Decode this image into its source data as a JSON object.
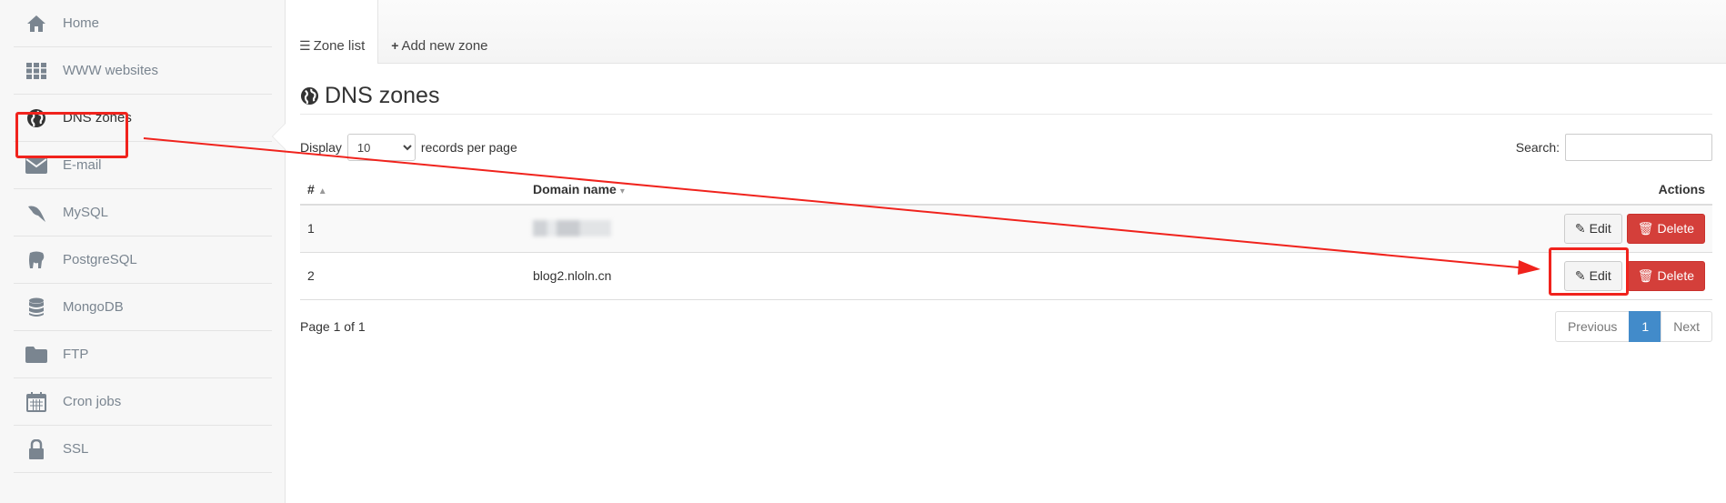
{
  "sidebar": {
    "items": [
      {
        "label": "Home",
        "icon": "home-icon"
      },
      {
        "label": "WWW websites",
        "icon": "grid-icon"
      },
      {
        "label": "DNS zones",
        "icon": "globe-icon"
      },
      {
        "label": "E-mail",
        "icon": "envelope-icon"
      },
      {
        "label": "MySQL",
        "icon": "dolphin-icon"
      },
      {
        "label": "PostgreSQL",
        "icon": "elephant-icon"
      },
      {
        "label": "MongoDB",
        "icon": "database-icon"
      },
      {
        "label": "FTP",
        "icon": "folder-icon"
      },
      {
        "label": "Cron jobs",
        "icon": "calendar-icon"
      },
      {
        "label": "SSL",
        "icon": "lock-icon"
      }
    ],
    "active_index": 2
  },
  "tabs": [
    {
      "label": "Zone list",
      "icon": "list-icon"
    },
    {
      "label": "Add new zone",
      "icon": "plus-icon"
    }
  ],
  "page": {
    "title": "DNS zones"
  },
  "toolbar": {
    "display_label": "Display",
    "page_size": "10",
    "records_label": "records per page",
    "search_label": "Search:"
  },
  "table": {
    "headers": {
      "num": "#",
      "domain": "Domain name",
      "actions": "Actions"
    },
    "rows": [
      {
        "num": "1",
        "domain": ""
      },
      {
        "num": "2",
        "domain": "blog2.nloln.cn"
      }
    ],
    "edit_label": "Edit",
    "delete_label": "Delete"
  },
  "footer": {
    "page_info": "Page 1 of 1",
    "prev_label": "Previous",
    "current_page": "1",
    "next_label": "Next"
  },
  "colors": {
    "annotation": "#f0231d",
    "delete": "#d43f3a",
    "pager_active": "#428bca"
  }
}
